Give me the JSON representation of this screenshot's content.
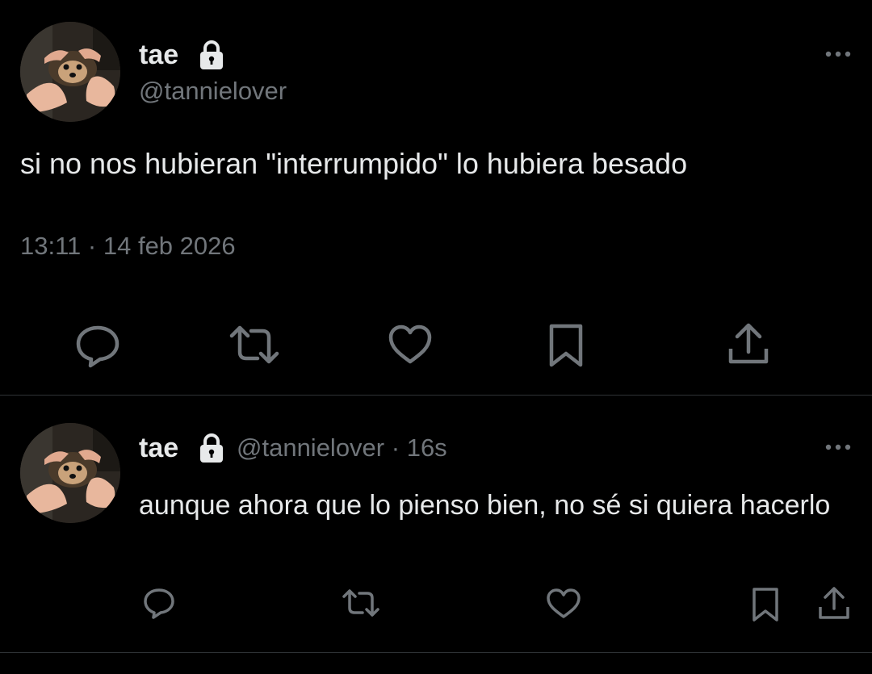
{
  "tweet": {
    "display_name": "tae",
    "handle": "@tannielover",
    "text": "si no nos hubieran \"interrumpido\" lo hubiera besado",
    "time": "13:11",
    "separator": "·",
    "date": "14 feb 2026",
    "icons": [
      "more-icon",
      "lock-icon",
      "reply-icon",
      "retweet-icon",
      "like-icon",
      "bookmark-icon",
      "share-icon"
    ]
  },
  "reply": {
    "display_name": "tae",
    "handle": "@tannielover",
    "separator": "·",
    "age": "16s",
    "text": "aunque ahora que lo pienso bien, no sé si quiera hacerlo"
  },
  "colors": {
    "background": "#000000",
    "text": "#e7e9ea",
    "secondary": "#71767b",
    "divider": "#2f3336"
  }
}
